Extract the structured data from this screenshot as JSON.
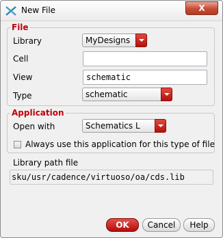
{
  "window": {
    "title": "New File",
    "close_label": "X"
  },
  "file_group": {
    "title": "File",
    "library_label": "Library",
    "library_value": "MyDesigns",
    "cell_label": "Cell",
    "cell_value": "",
    "view_label": "View",
    "view_value": "schematic",
    "type_label": "Type",
    "type_value": "schematic"
  },
  "application_group": {
    "title": "Application",
    "open_with_label": "Open with",
    "open_with_value": "Schematics L",
    "always_use_label": "Always use this application for this type of file",
    "always_use_checked": false
  },
  "library_path": {
    "label": "Library path file",
    "value": "sku/usr/cadence/virtuoso/oa/cds.lib"
  },
  "buttons": {
    "ok": "OK",
    "cancel": "Cancel",
    "help": "Help"
  },
  "colors": {
    "accent": "#c0000d",
    "ok_button": "#c01010",
    "dropdown_arrow": "#c8201a"
  },
  "icons": {
    "app": "cross-x-icon",
    "dropdown": "chevron-down-icon"
  }
}
